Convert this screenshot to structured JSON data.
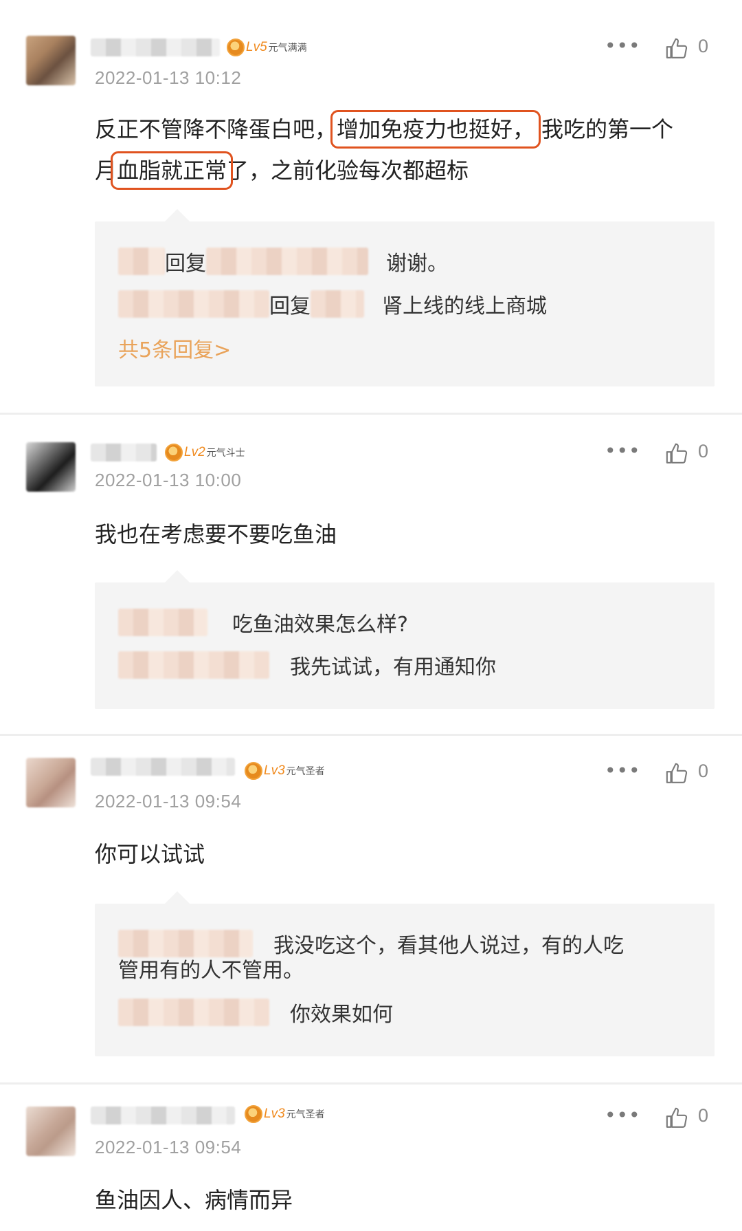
{
  "comments": [
    {
      "level": "Lv5",
      "level_title": "元气满满",
      "timestamp": "2022-01-13 10:12",
      "likes": "0",
      "text_parts": [
        "反正不管降不降蛋白吧，",
        "增加免疫力也挺好，",
        "我吃的第一个",
        "月",
        "血脂就正常",
        "了，之前化验每次都超标"
      ],
      "highlighted": [
        "增加免疫力也挺好，",
        "血脂就正常"
      ],
      "replies": [
        {
          "connector": "回复",
          "text": "谢谢。"
        },
        {
          "connector": "回复",
          "text": "肾上线的线上商城"
        }
      ],
      "more_replies": "共5条回复>"
    },
    {
      "level": "Lv2",
      "level_title": "元气斗士",
      "timestamp": "2022-01-13 10:00",
      "likes": "0",
      "text": "我也在考虑要不要吃鱼油",
      "replies": [
        {
          "text": "吃鱼油效果怎么样?"
        },
        {
          "text": "我先试试，有用通知你"
        }
      ]
    },
    {
      "level": "Lv3",
      "level_title": "元气圣者",
      "timestamp": "2022-01-13 09:54",
      "likes": "0",
      "text": "你可以试试",
      "replies": [
        {
          "text": "我没吃这个，看其他人说过，有的人吃",
          "text_cont": "管用有的人不管用。"
        },
        {
          "text": "你效果如何"
        }
      ]
    },
    {
      "level": "Lv3",
      "level_title": "元气圣者",
      "timestamp": "2022-01-13 09:54",
      "likes": "0",
      "text": "鱼油因人、病情而异"
    }
  ],
  "icons": {
    "more": "more-dots-icon",
    "like": "thumbs-up-icon",
    "badge": "level-medal-icon"
  },
  "colors": {
    "highlight_box": "#e0531f",
    "more_replies": "#e9a35a",
    "level_text": "#f08a1e",
    "timestamp": "#a0a0a0"
  }
}
